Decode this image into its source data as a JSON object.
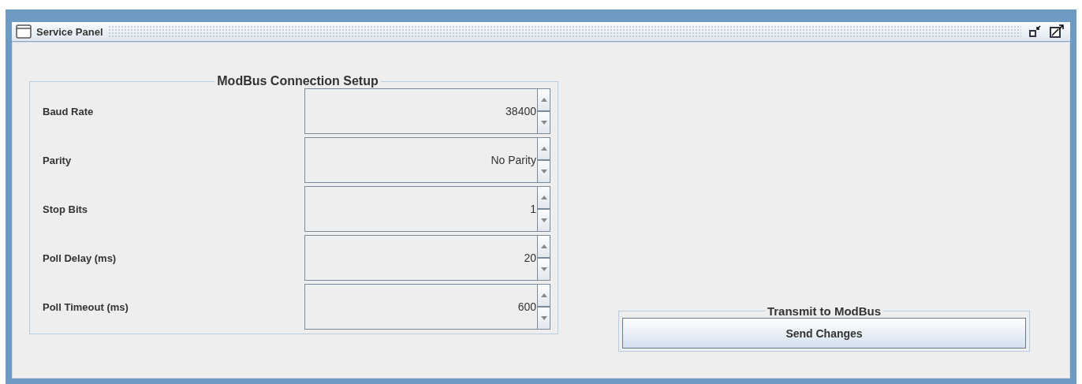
{
  "window": {
    "title": "Service Panel"
  },
  "connection_setup": {
    "title": "ModBus Connection Setup",
    "fields": [
      {
        "label": "Baud Rate",
        "value": "38400"
      },
      {
        "label": "Parity",
        "value": "No Parity"
      },
      {
        "label": "Stop Bits",
        "value": "1"
      },
      {
        "label": "Poll Delay (ms)",
        "value": "20"
      },
      {
        "label": "Poll Timeout (ms)",
        "value": "600"
      }
    ]
  },
  "transmit": {
    "title": "Transmit to ModBus",
    "button": "Send Changes"
  }
}
